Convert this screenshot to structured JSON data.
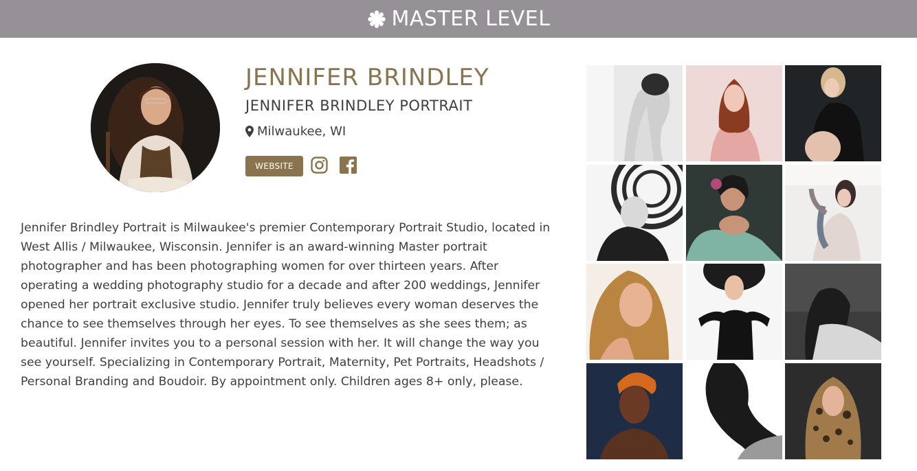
{
  "banner": {
    "title": "MASTER LEVEL",
    "icon": "award-rosette-icon"
  },
  "profile": {
    "name": "JENNIFER BRINDLEY",
    "studio": "JENNIFER BRINDLEY PORTRAIT",
    "location": "Milwaukee, WI",
    "website_label": "WEBSITE",
    "accent_color": "#8a7450",
    "banner_color": "#969196"
  },
  "social": {
    "instagram_icon": "instagram-icon",
    "facebook_icon": "facebook-icon"
  },
  "bio": "Jennifer Brindley Portrait is Milwaukee's premier Contemporary Portrait Studio, located in West Allis / Milwaukee, Wisconsin. Jennifer is an award-winning Master portrait photographer and has been photographing women for over thirteen years. After operating a wedding photography studio for a decade and after 200 weddings, Jennifer opened her portrait exclusive studio. Jennifer truly believes every woman deserves the chance to see themselves through her eyes. To see themselves as she sees them; as beautiful. Jennifer invites you to a personal session with her. It will change the way you see yourself. Specializing in Contemporary Portrait, Maternity, Pet Portraits, Headshots / Personal Branding and Boudoir. By appointment only. Children ages 8+ only, please.",
  "gallery": {
    "count": 12
  }
}
